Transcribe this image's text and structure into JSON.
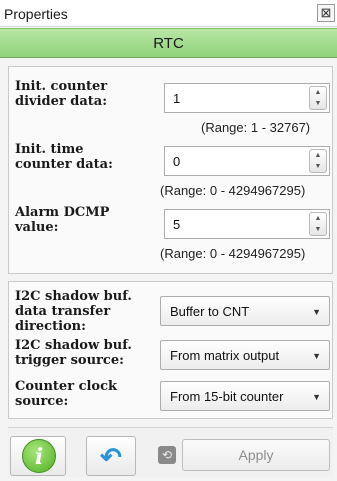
{
  "window": {
    "title": "Properties",
    "close_glyph": "⊠"
  },
  "header": {
    "label": "RTC",
    "color": "#9fdc8a"
  },
  "fields": [
    {
      "label_line1": "Init. counter",
      "label_line2": "divider data:",
      "value": "1",
      "range": "(Range:  1 - 32767)"
    },
    {
      "label_line1": "Init. time",
      "label_line2": "counter data:",
      "value": "0",
      "range": "(Range:  0 - 4294967295)"
    },
    {
      "label_line1": "Alarm DCMP",
      "label_line2": "value:",
      "value": "5",
      "range": "(Range:  0 - 4294967295)"
    }
  ],
  "dropdowns": [
    {
      "label_line1": "I2C shadow buf.",
      "label_line2": "data transfer",
      "label_line3": "direction:",
      "value": "Buffer to CNT"
    },
    {
      "label_line1": "I2C shadow buf.",
      "label_line2": "trigger source:",
      "value": "From matrix output"
    },
    {
      "label_line1": "Counter clock",
      "label_line2": "source:",
      "value": "From 15-bit counter"
    }
  ],
  "footer": {
    "info_icon": "info-icon",
    "info_glyph": "i",
    "undo_icon": "undo-icon",
    "undo_glyph": "↶",
    "restore_icon": "restore-icon",
    "apply_label": "Apply"
  }
}
